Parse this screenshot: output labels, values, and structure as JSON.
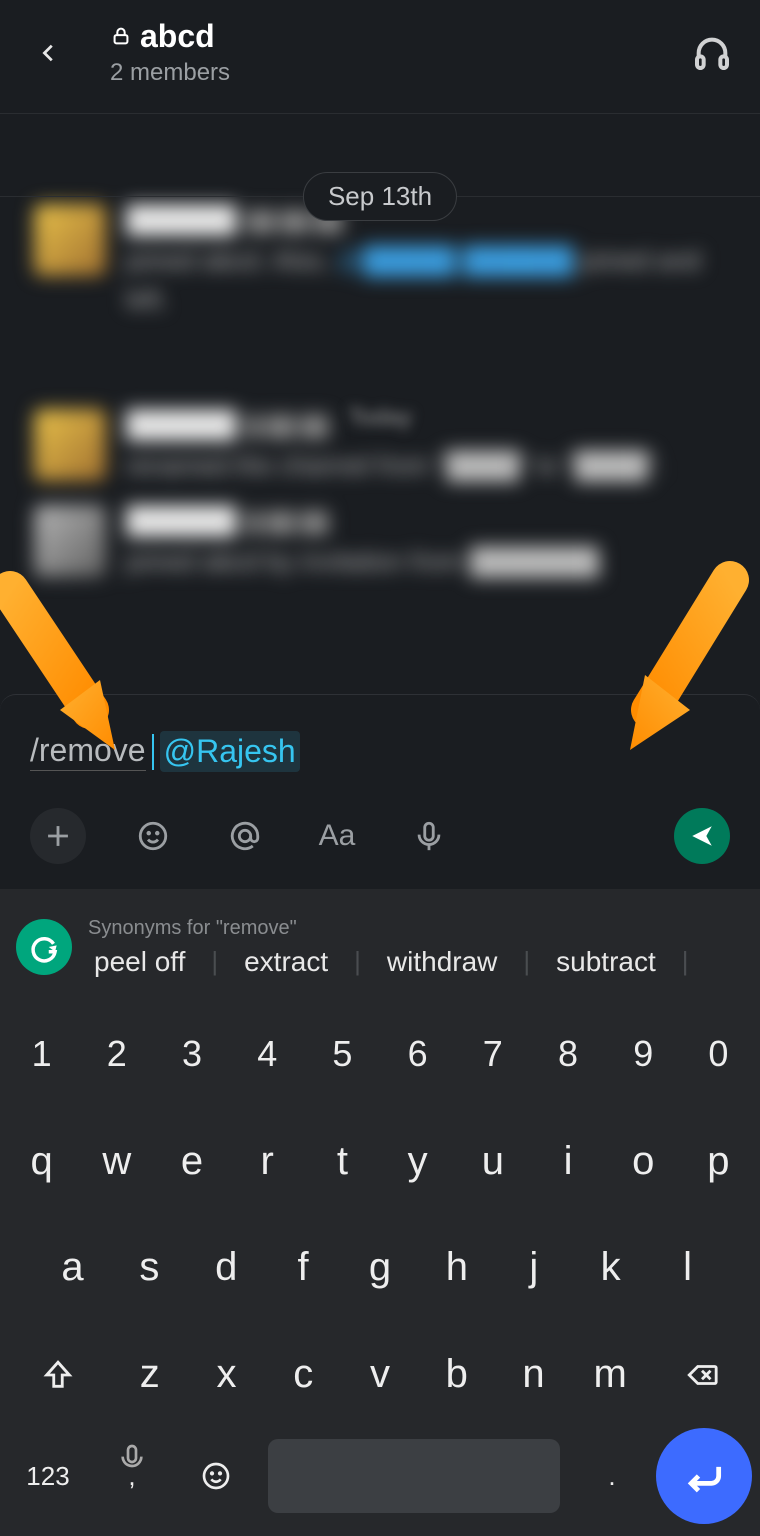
{
  "header": {
    "title": "abcd",
    "subtitle": "2 members"
  },
  "date_separator": "Sep 13th",
  "today_separator": "Today",
  "composer": {
    "command": "/remove",
    "mention": "@Rajesh",
    "format_label": "Aa"
  },
  "suggestions": {
    "label": "Synonyms for \"remove\"",
    "items": [
      "peel off",
      "extract",
      "withdraw",
      "subtract"
    ]
  },
  "keyboard": {
    "row_nums": [
      "1",
      "2",
      "3",
      "4",
      "5",
      "6",
      "7",
      "8",
      "9",
      "0"
    ],
    "row_top": [
      "q",
      "w",
      "e",
      "r",
      "t",
      "y",
      "u",
      "i",
      "o",
      "p"
    ],
    "row_mid": [
      "a",
      "s",
      "d",
      "f",
      "g",
      "h",
      "j",
      "k",
      "l"
    ],
    "row_bot": [
      "z",
      "x",
      "c",
      "v",
      "b",
      "n",
      "m"
    ],
    "mode_label": "123",
    "comma": ",",
    "period": "."
  }
}
